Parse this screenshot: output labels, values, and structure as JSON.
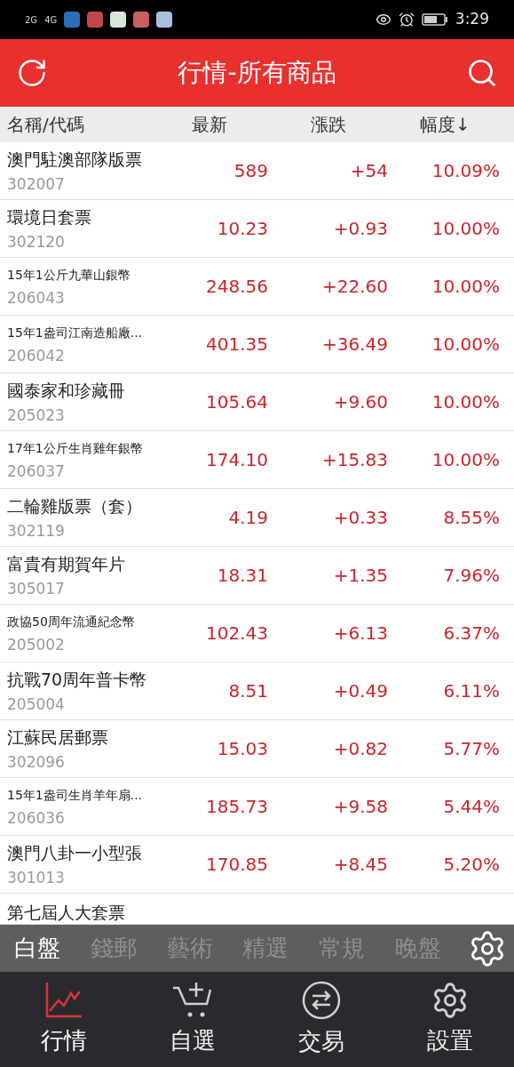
{
  "status_bar": {
    "signal_labels": [
      "2G",
      "4G"
    ],
    "time": "3:29"
  },
  "header": {
    "title": "行情-所有商品"
  },
  "table": {
    "columns": [
      {
        "label": "名稱/代碼"
      },
      {
        "label": "最新"
      },
      {
        "label": "漲跌"
      },
      {
        "label": "幅度↓"
      }
    ],
    "rows": [
      {
        "name": "澳門駐澳部隊版票",
        "kind": "large",
        "code": "302007",
        "price": "589",
        "change": "+54",
        "pct": "10.09%"
      },
      {
        "name": "環境日套票",
        "kind": "large",
        "code": "302120",
        "price": "10.23",
        "change": "+0.93",
        "pct": "10.00%"
      },
      {
        "name": "15年1公斤九華山銀幣",
        "kind": "small",
        "code": "206043",
        "price": "248.56",
        "change": "+22.60",
        "pct": "10.00%"
      },
      {
        "name": "15年1盎司江南造船廠...",
        "kind": "small",
        "code": "206042",
        "price": "401.35",
        "change": "+36.49",
        "pct": "10.00%"
      },
      {
        "name": "國泰家和珍藏冊",
        "kind": "large",
        "code": "205023",
        "price": "105.64",
        "change": "+9.60",
        "pct": "10.00%"
      },
      {
        "name": "17年1公斤生肖雞年銀幣",
        "kind": "small",
        "code": "206037",
        "price": "174.10",
        "change": "+15.83",
        "pct": "10.00%"
      },
      {
        "name": "二輪雞版票（套）",
        "kind": "large",
        "code": "302119",
        "price": "4.19",
        "change": "+0.33",
        "pct": "8.55%"
      },
      {
        "name": "富貴有期賀年片",
        "kind": "large",
        "code": "305017",
        "price": "18.31",
        "change": "+1.35",
        "pct": "7.96%"
      },
      {
        "name": "政協50周年流通紀念幣",
        "kind": "small",
        "code": "205002",
        "price": "102.43",
        "change": "+6.13",
        "pct": "6.37%"
      },
      {
        "name": "抗戰70周年普卡幣",
        "kind": "large",
        "code": "205004",
        "price": "8.51",
        "change": "+0.49",
        "pct": "6.11%"
      },
      {
        "name": "江蘇民居郵票",
        "kind": "large",
        "code": "302096",
        "price": "15.03",
        "change": "+0.82",
        "pct": "5.77%"
      },
      {
        "name": "15年1盎司生肖羊年扇...",
        "kind": "small",
        "code": "206036",
        "price": "185.73",
        "change": "+9.58",
        "pct": "5.44%"
      },
      {
        "name": "澳門八卦一小型張",
        "kind": "large",
        "code": "301013",
        "price": "170.85",
        "change": "+8.45",
        "pct": "5.20%"
      },
      {
        "name": "第七屆人大套票",
        "kind": "large"
      }
    ]
  },
  "category_tabs": [
    {
      "label": "白盤",
      "selected": true
    },
    {
      "label": "錢郵",
      "selected": false
    },
    {
      "label": "藝術",
      "selected": false
    },
    {
      "label": "精選",
      "selected": false
    },
    {
      "label": "常規",
      "selected": false
    },
    {
      "label": "晚盤",
      "selected": false
    }
  ],
  "bottom_nav": [
    {
      "label": "行情",
      "kind": "chart",
      "selected": true
    },
    {
      "label": "自選",
      "kind": "cart",
      "selected": false
    },
    {
      "label": "交易",
      "kind": "exchange",
      "selected": false
    },
    {
      "label": "設置",
      "kind": "settings",
      "selected": false
    }
  ]
}
